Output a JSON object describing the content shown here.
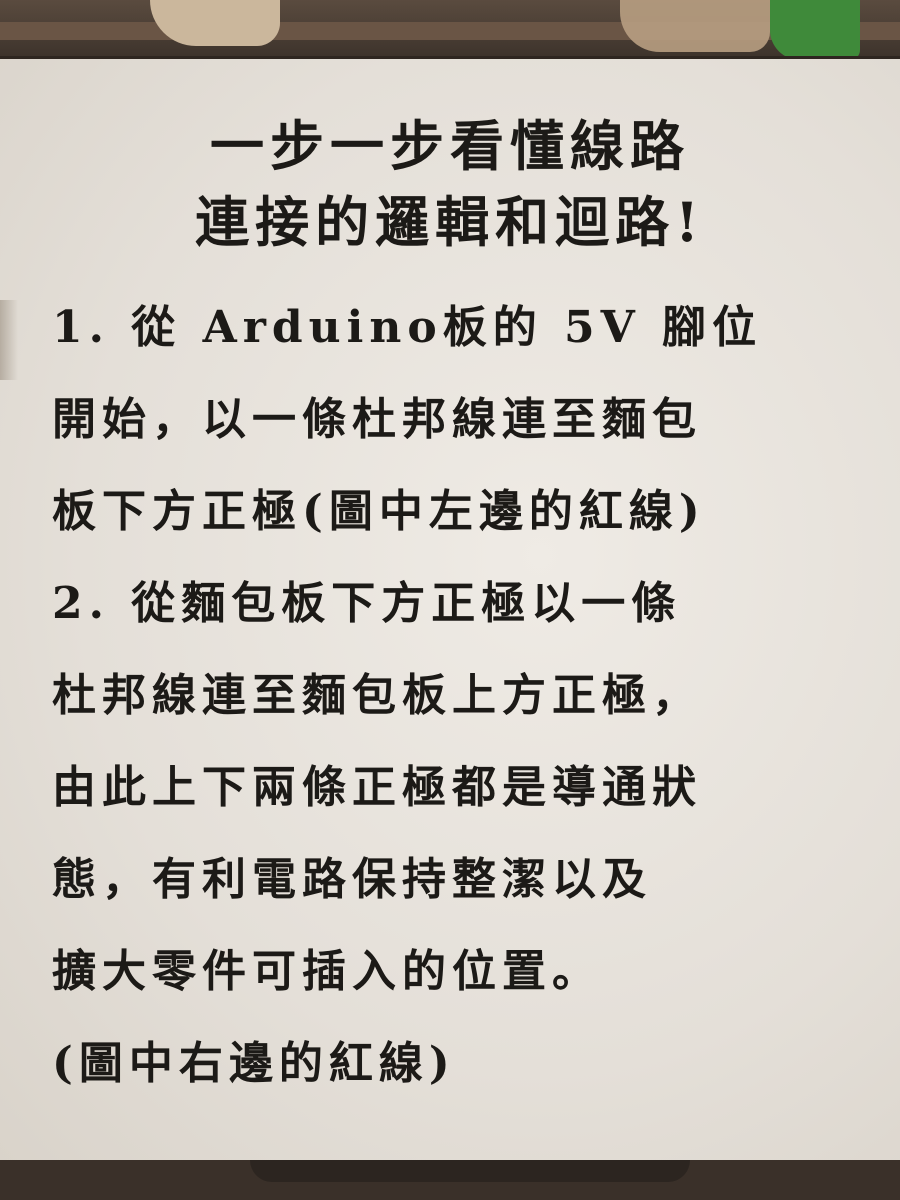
{
  "title": {
    "line1": "一步一步看懂線路",
    "line2": "連接的邏輯和迴路!"
  },
  "body": {
    "lines": [
      "1. 從 Arduino板的 5V 腳位",
      "開始，以一條杜邦線連至麵包",
      "板下方正極(圖中左邊的紅線)",
      "2. 從麵包板下方正極以一條",
      "杜邦線連至麵包板上方正極，",
      "由此上下兩條正極都是導通狀",
      "態，有利電路保持整潔以及",
      "擴大零件可插入的位置。",
      "(圖中右邊的紅線)"
    ]
  },
  "colors": {
    "text": "#1c1a17",
    "board": "#e8e4de",
    "frame": "#3e342c"
  }
}
